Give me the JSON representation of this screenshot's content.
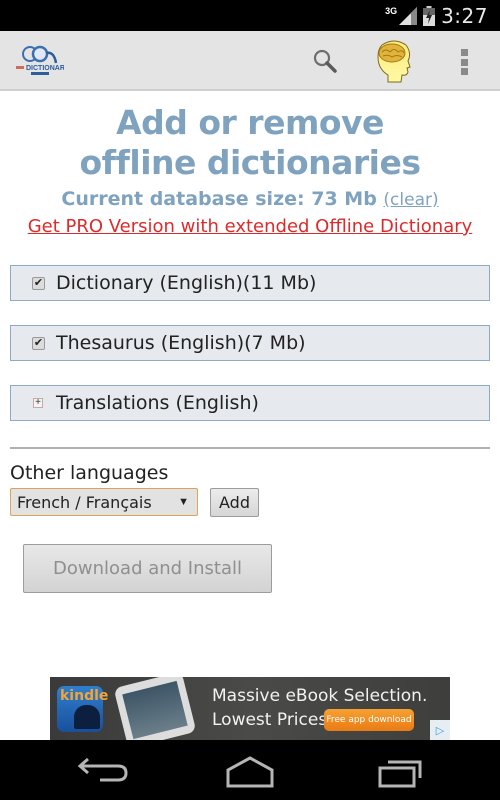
{
  "status_bar": {
    "network": "3G",
    "time": "3:27",
    "icons": [
      "signal-icon",
      "battery-charging-icon"
    ]
  },
  "action_bar": {
    "logo_text": "The Free DICTIONARY by FARLEX",
    "icons": [
      "search-icon",
      "brain-game-icon",
      "overflow-menu-icon"
    ]
  },
  "main": {
    "title": "Add or remove offline dictionaries",
    "db_size_label": "Current database size: 73 Mb",
    "clear_link": "(clear)",
    "pro_link": "Get PRO Version with extended Offline Dictionary",
    "dictionaries": [
      {
        "label": "Dictionary (English)(11 Mb)",
        "control": "checkbox",
        "checked": true
      },
      {
        "label": "Thesaurus (English)(7 Mb)",
        "control": "checkbox",
        "checked": true
      },
      {
        "label": "Translations (English)",
        "control": "expand",
        "checked": false
      }
    ],
    "other_languages_label": "Other languages",
    "language_select": {
      "selected": "French / Français"
    },
    "add_button": "Add",
    "download_button": "Download and Install"
  },
  "ad": {
    "brand": "kindle",
    "line1": "Massive eBook Selection.",
    "line2": "Lowest Prices.",
    "cta": "Free app download"
  },
  "nav_bar": {
    "buttons": [
      "back",
      "home",
      "recent-apps"
    ]
  },
  "colors": {
    "title": "#7fa2bf",
    "pro_link": "#dd2a2a",
    "row_border": "#8faac5",
    "row_bg": "#e6e9ed",
    "select_border": "#d9a557"
  }
}
